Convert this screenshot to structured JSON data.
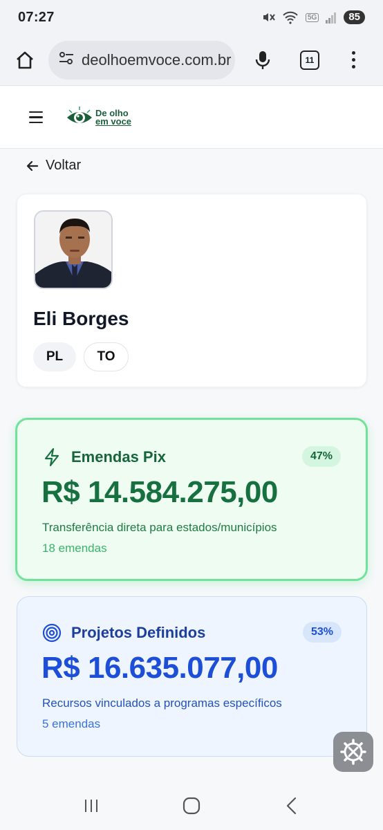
{
  "status_bar": {
    "time": "07:27",
    "battery": "85",
    "network": "5G"
  },
  "browser": {
    "url": "deolhoemvoce.com.br",
    "tabs_count": "11"
  },
  "site": {
    "logo_text_line1": "De olho",
    "logo_text_line2": "em voce"
  },
  "nav": {
    "back_label": "Voltar"
  },
  "profile": {
    "name": "Eli Borges",
    "party": "PL",
    "state": "TO"
  },
  "emendas_pix": {
    "title": "Emendas Pix",
    "percent": "47%",
    "amount": "R$ 14.584.275,00",
    "description": "Transferência direta para estados/municípios",
    "count": "18 emendas",
    "accent": "#17703f"
  },
  "projetos": {
    "title": "Projetos Definidos",
    "percent": "53%",
    "amount": "R$ 16.635.077,00",
    "description": "Recursos vinculados a programas específicos",
    "count": "5 emendas",
    "accent": "#1d4ed8"
  }
}
